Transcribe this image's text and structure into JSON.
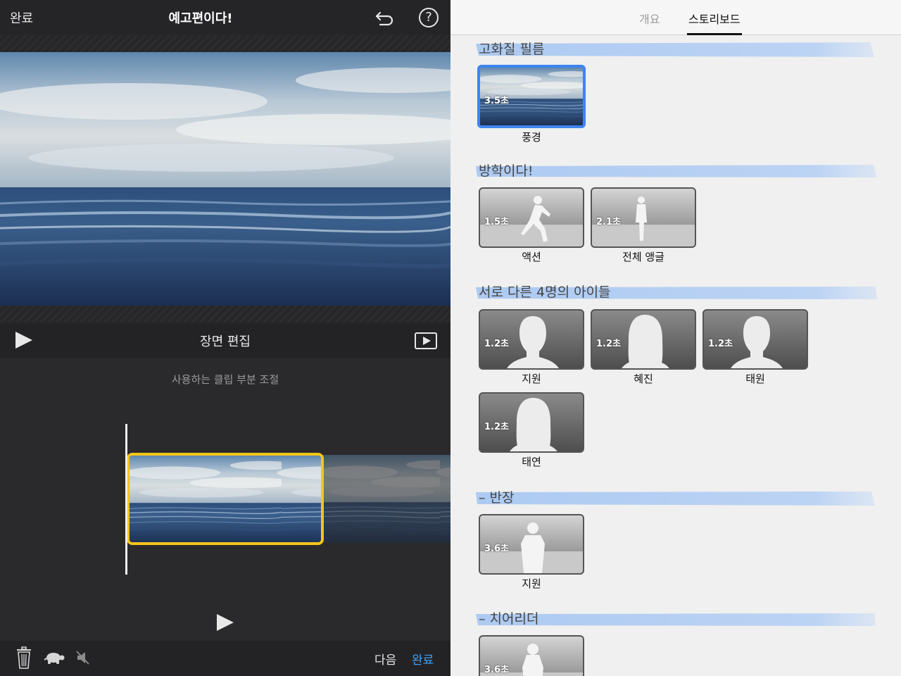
{
  "editor": {
    "done_label": "완료",
    "title": "예고편이다!",
    "scene_title": "장면 편집",
    "trim_hint": "사용하는 클립 부분 조절",
    "next_label": "다음",
    "confirm_label": "완료"
  },
  "storyboard": {
    "tabs": [
      "개요",
      "스토리보드"
    ],
    "active_tab": "스토리보드",
    "sections": [
      {
        "title": "고화질 필름",
        "shots": [
          {
            "duration": "3.5초",
            "label": "풍경",
            "selected": true,
            "thumb": "video"
          }
        ]
      },
      {
        "title": "방학이다!",
        "shots": [
          {
            "duration": "1.5초",
            "label": "액션",
            "thumb": "action-silhouette"
          },
          {
            "duration": "2.1초",
            "label": "전체 앵글",
            "thumb": "wide-silhouette"
          }
        ]
      },
      {
        "title": "서로 다른 4명의 아이들",
        "shots": [
          {
            "duration": "1.2초",
            "label": "지원",
            "thumb": "headshot-short-hair"
          },
          {
            "duration": "1.2초",
            "label": "혜진",
            "thumb": "headshot-long-hair"
          },
          {
            "duration": "1.2초",
            "label": "태원",
            "thumb": "headshot-short-hair"
          },
          {
            "duration": "1.2초",
            "label": "태연",
            "thumb": "headshot-long-hair"
          }
        ]
      },
      {
        "title": "– 반장",
        "shots": [
          {
            "duration": "3.6초",
            "label": "지원",
            "thumb": "medium-silhouette"
          }
        ]
      },
      {
        "title": "– 치어리더",
        "shots": [
          {
            "duration": "3.6초",
            "label": "",
            "thumb": "medium-silhouette-female"
          }
        ]
      }
    ]
  },
  "colors": {
    "accent_blue": "#3ca5ff",
    "selection_yellow": "#f4c51b",
    "storyboard_selection": "#3f84f0",
    "brush_stroke": "#a9c8f2"
  },
  "icons": [
    "undo-icon",
    "help-icon",
    "play-icon",
    "fullscreen-icon",
    "trash-icon",
    "turtle-icon",
    "mute-icon"
  ]
}
